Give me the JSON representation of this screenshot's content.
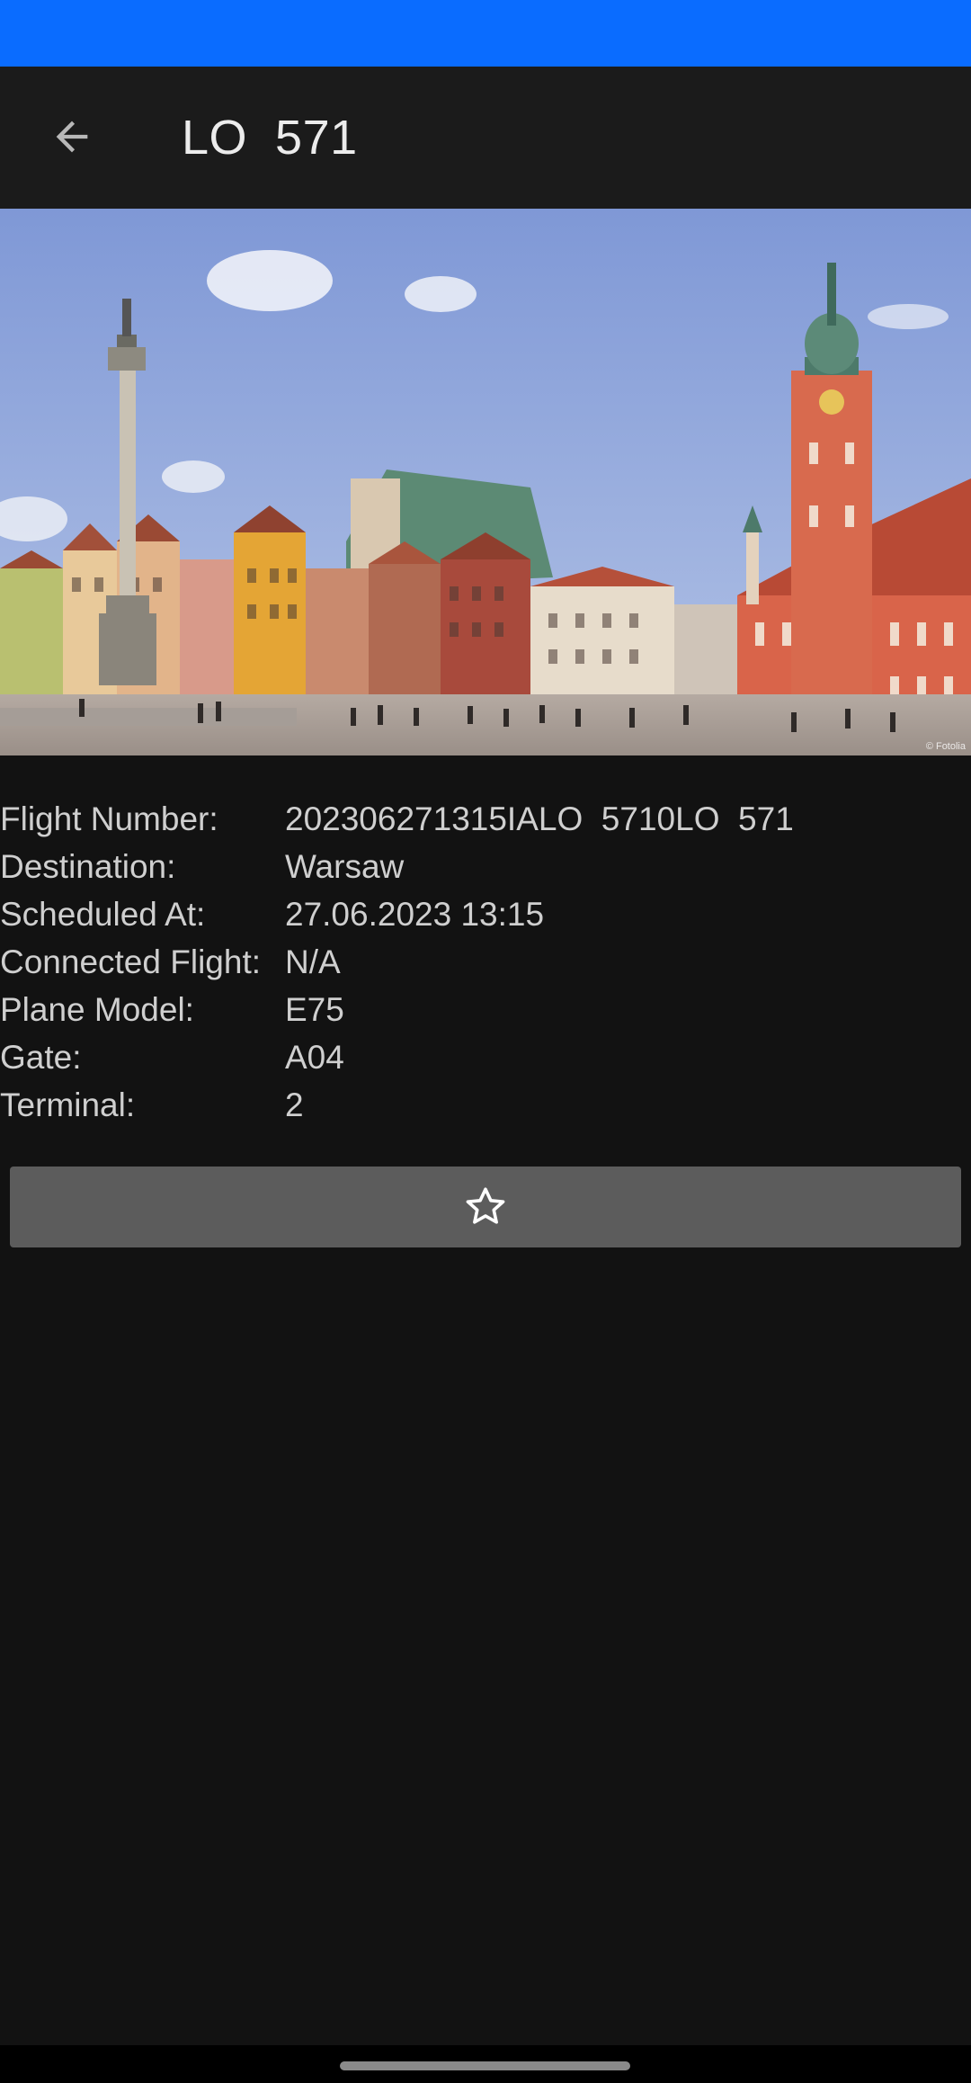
{
  "status_bar": {
    "color": "#0a6cff"
  },
  "app_bar": {
    "back_icon": "arrow-back-icon",
    "title": "LO  571"
  },
  "destination_image": {
    "description_icon": "city-photo",
    "credit": "© Fotolia"
  },
  "flight_details": {
    "rows": [
      {
        "label": "Flight Number:",
        "value": "202306271315IALO  5710LO  571"
      },
      {
        "label": "Destination:",
        "value": "Warsaw"
      },
      {
        "label": "Scheduled At:",
        "value": "27.06.2023 13:15"
      },
      {
        "label": "Connected Flight:",
        "value": "N/A"
      },
      {
        "label": "Plane Model:",
        "value": "E75"
      },
      {
        "label": "Gate:",
        "value": "A04"
      },
      {
        "label": "Terminal:",
        "value": "2"
      }
    ]
  },
  "favorite_button": {
    "icon": "star-outline-icon"
  },
  "colors": {
    "background": "#121212",
    "app_bar": "#1b1b1b",
    "button": "#5c5c5c",
    "text": "#cfcfcf"
  }
}
